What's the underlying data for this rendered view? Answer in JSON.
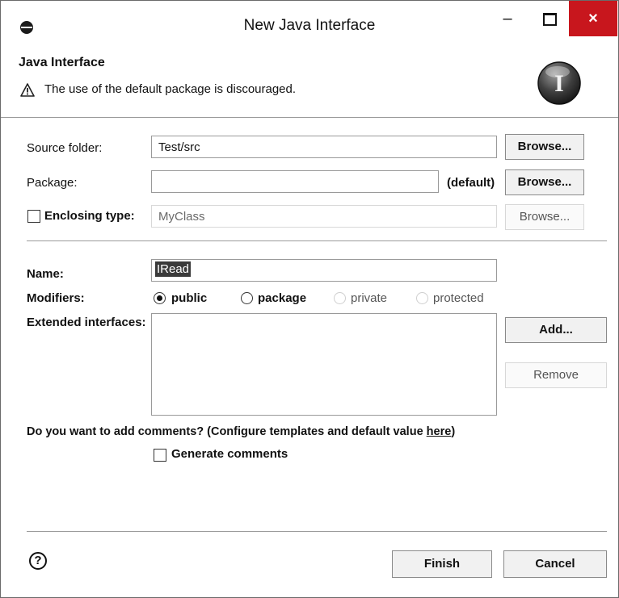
{
  "window": {
    "title": "New Java Interface",
    "minimize_glyph": "–",
    "close_glyph": "×"
  },
  "banner": {
    "title": "Java Interface",
    "message": "The use of the default package is discouraged.",
    "big_icon_letter": "I"
  },
  "source_folder": {
    "label": "Source folder:",
    "value": "Test/src",
    "browse": "Browse..."
  },
  "package": {
    "label": "Package:",
    "value": "",
    "suffix": "(default)",
    "browse": "Browse..."
  },
  "enclosing_type": {
    "label": "Enclosing type:",
    "value": "MyClass",
    "browse": "Browse...",
    "checked": false
  },
  "name": {
    "label": "Name:",
    "value": "IRead"
  },
  "modifiers": {
    "label": "Modifiers:",
    "options": [
      {
        "label": "public",
        "selected": true,
        "enabled": true
      },
      {
        "label": "package",
        "selected": false,
        "enabled": true
      },
      {
        "label": "private",
        "selected": false,
        "enabled": false
      },
      {
        "label": "protected",
        "selected": false,
        "enabled": false
      }
    ]
  },
  "extended_interfaces": {
    "label": "Extended interfaces:",
    "add": "Add...",
    "remove": "Remove"
  },
  "comments": {
    "question_prefix": "Do you want to add comments? (Configure templates and default value ",
    "link": "here",
    "question_suffix": ")",
    "generate_label": "Generate comments",
    "checked": false
  },
  "footer": {
    "help_glyph": "?",
    "finish": "Finish",
    "cancel": "Cancel"
  },
  "colors": {
    "close_button": "#c8161d",
    "selection": "#3a3a3a"
  }
}
